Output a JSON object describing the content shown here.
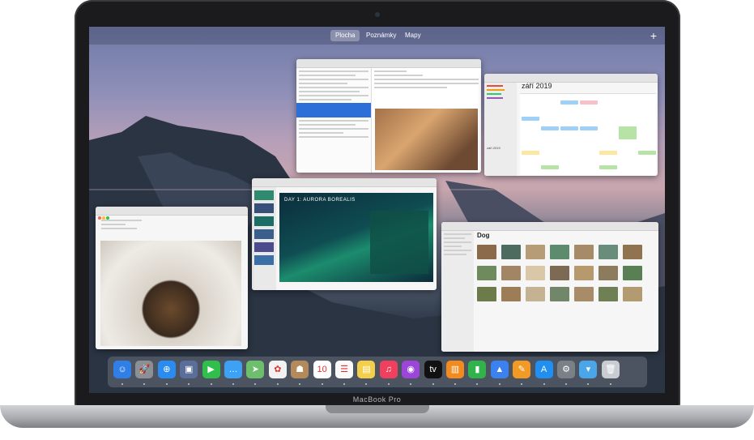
{
  "device": {
    "brand_label": "MacBook Pro"
  },
  "menubar": {
    "items": [
      {
        "label": "Plocha",
        "active": true
      },
      {
        "label": "Poznámky",
        "active": false
      },
      {
        "label": "Mapy",
        "active": false
      }
    ],
    "add_label": "+"
  },
  "calendar": {
    "month_label": "září 2019",
    "mini_month_label": "září 2019"
  },
  "keynote": {
    "slide_title": "DAY 1: AURORA BOREALIS"
  },
  "photos": {
    "album_title": "Dog"
  },
  "dock": {
    "apps": [
      {
        "name": "finder-icon",
        "glyph": "☺",
        "color": "#2f7fe6"
      },
      {
        "name": "launchpad-icon",
        "glyph": "🚀",
        "color": "#8b8f96"
      },
      {
        "name": "safari-icon",
        "glyph": "⊕",
        "color": "#2a8cf0"
      },
      {
        "name": "photo-booth-icon",
        "glyph": "▣",
        "color": "#5b6e9a"
      },
      {
        "name": "facetime-icon",
        "glyph": "▶",
        "color": "#2fbf4a"
      },
      {
        "name": "messages-icon",
        "glyph": "…",
        "color": "#3da2f5"
      },
      {
        "name": "maps-icon",
        "glyph": "➤",
        "color": "#6dbf6b"
      },
      {
        "name": "photos-icon",
        "glyph": "✿",
        "color": "#f2f2f2"
      },
      {
        "name": "contacts-icon",
        "glyph": "☗",
        "color": "#b48a5a"
      },
      {
        "name": "calendar-icon",
        "glyph": "10",
        "color": "#ffffff"
      },
      {
        "name": "reminders-icon",
        "glyph": "☰",
        "color": "#fafafa"
      },
      {
        "name": "notes-icon",
        "glyph": "▤",
        "color": "#f4d04a"
      },
      {
        "name": "music-icon",
        "glyph": "♫",
        "color": "#f0405e"
      },
      {
        "name": "podcasts-icon",
        "glyph": "◉",
        "color": "#9b45d9"
      },
      {
        "name": "tv-icon",
        "glyph": "tv",
        "color": "#111111"
      },
      {
        "name": "books-icon",
        "glyph": "▥",
        "color": "#f28a1e"
      },
      {
        "name": "numbers-icon",
        "glyph": "▮",
        "color": "#2fb34a"
      },
      {
        "name": "keynote-icon",
        "glyph": "▲",
        "color": "#3b82f0"
      },
      {
        "name": "pages-icon",
        "glyph": "✎",
        "color": "#f39a24"
      },
      {
        "name": "app-store-icon",
        "glyph": "A",
        "color": "#1f8ff2"
      },
      {
        "name": "system-preferences-icon",
        "glyph": "⚙",
        "color": "#7b7f86"
      },
      {
        "name": "downloads-folder-icon",
        "glyph": "▾",
        "color": "#4aa6e8"
      },
      {
        "name": "trash-icon",
        "glyph": "🗑",
        "color": "#c9ccd1"
      }
    ]
  }
}
